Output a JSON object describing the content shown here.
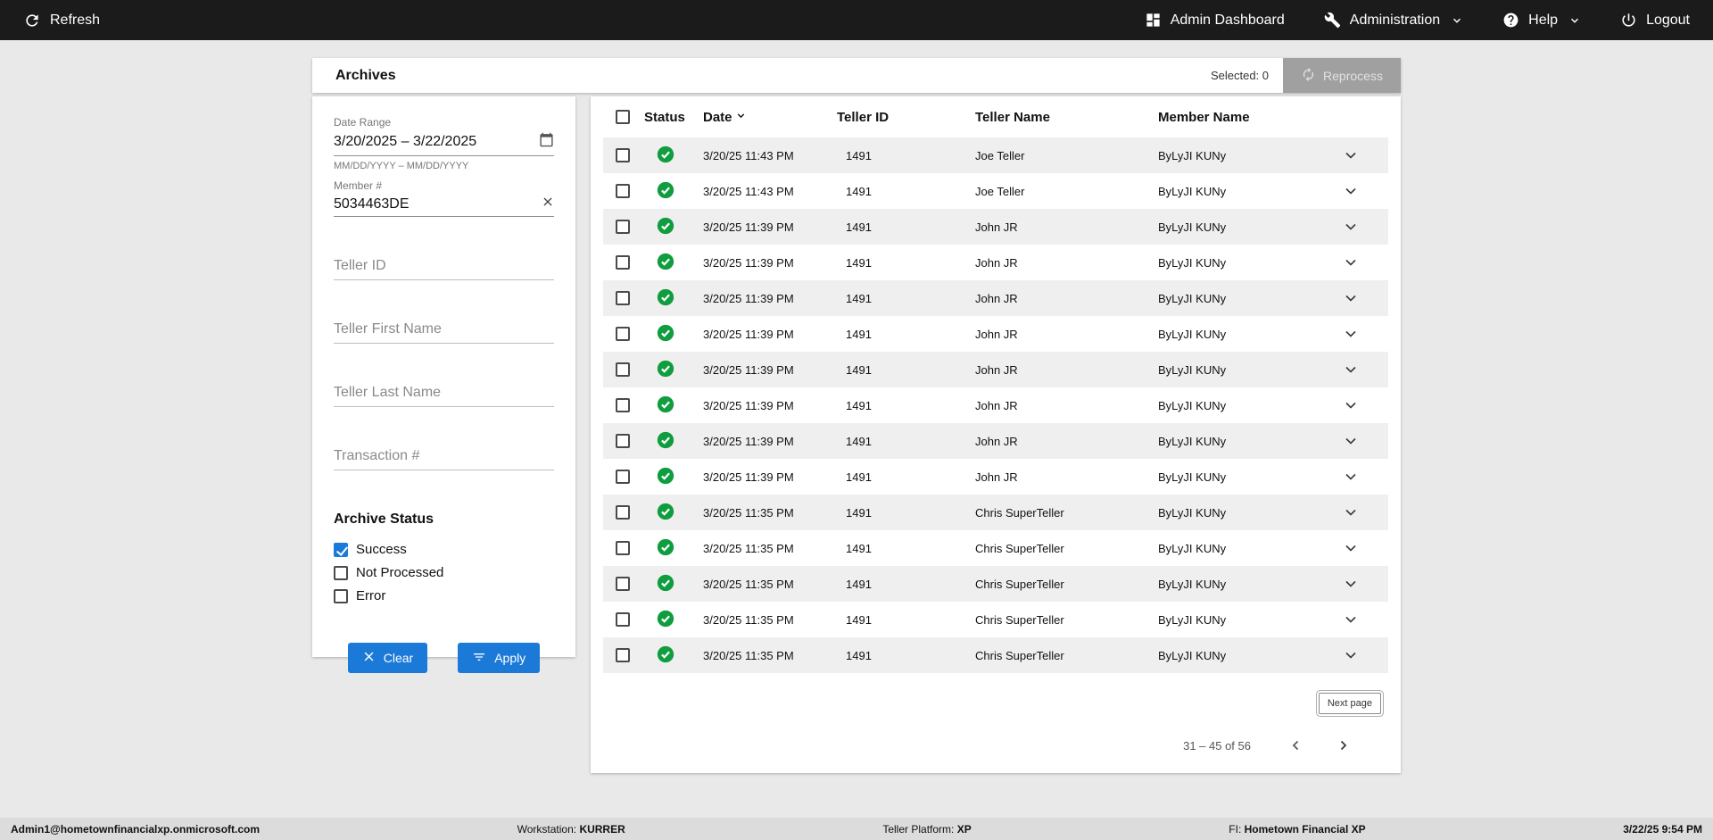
{
  "topbar": {
    "refresh": "Refresh",
    "admin_dashboard": "Admin Dashboard",
    "administration": "Administration",
    "help": "Help",
    "logout": "Logout"
  },
  "header": {
    "title": "Archives",
    "selected": "Selected: 0",
    "reprocess": "Reprocess"
  },
  "filters": {
    "date_range": {
      "label": "Date Range",
      "value": "3/20/2025 – 3/22/2025",
      "hint": "MM/DD/YYYY – MM/DD/YYYY"
    },
    "member": {
      "label": "Member #",
      "value": "5034463DE"
    },
    "teller_id_placeholder": "Teller ID",
    "teller_first_name_placeholder": "Teller First Name",
    "teller_last_name_placeholder": "Teller Last Name",
    "transaction_placeholder": "Transaction #",
    "archive_status_title": "Archive Status",
    "statuses": [
      {
        "label": "Success",
        "checked": true
      },
      {
        "label": "Not Processed",
        "checked": false
      },
      {
        "label": "Error",
        "checked": false
      }
    ],
    "clear": "Clear",
    "apply": "Apply"
  },
  "table": {
    "headers": {
      "status": "Status",
      "date": "Date",
      "teller_id": "Teller ID",
      "teller_name": "Teller Name",
      "member_name": "Member Name"
    },
    "rows": [
      {
        "date": "3/20/25 11:43 PM",
        "teller_id": "1491",
        "teller_name": "Joe Teller",
        "member_name": "ByLyJI KUNy"
      },
      {
        "date": "3/20/25 11:43 PM",
        "teller_id": "1491",
        "teller_name": "Joe Teller",
        "member_name": "ByLyJI KUNy"
      },
      {
        "date": "3/20/25 11:39 PM",
        "teller_id": "1491",
        "teller_name": "John JR",
        "member_name": "ByLyJI KUNy"
      },
      {
        "date": "3/20/25 11:39 PM",
        "teller_id": "1491",
        "teller_name": "John JR",
        "member_name": "ByLyJI KUNy"
      },
      {
        "date": "3/20/25 11:39 PM",
        "teller_id": "1491",
        "teller_name": "John JR",
        "member_name": "ByLyJI KUNy"
      },
      {
        "date": "3/20/25 11:39 PM",
        "teller_id": "1491",
        "teller_name": "John JR",
        "member_name": "ByLyJI KUNy"
      },
      {
        "date": "3/20/25 11:39 PM",
        "teller_id": "1491",
        "teller_name": "John JR",
        "member_name": "ByLyJI KUNy"
      },
      {
        "date": "3/20/25 11:39 PM",
        "teller_id": "1491",
        "teller_name": "John JR",
        "member_name": "ByLyJI KUNy"
      },
      {
        "date": "3/20/25 11:39 PM",
        "teller_id": "1491",
        "teller_name": "John JR",
        "member_name": "ByLyJI KUNy"
      },
      {
        "date": "3/20/25 11:39 PM",
        "teller_id": "1491",
        "teller_name": "John JR",
        "member_name": "ByLyJI KUNy"
      },
      {
        "date": "3/20/25 11:35 PM",
        "teller_id": "1491",
        "teller_name": "Chris SuperTeller",
        "member_name": "ByLyJI KUNy"
      },
      {
        "date": "3/20/25 11:35 PM",
        "teller_id": "1491",
        "teller_name": "Chris SuperTeller",
        "member_name": "ByLyJI KUNy"
      },
      {
        "date": "3/20/25 11:35 PM",
        "teller_id": "1491",
        "teller_name": "Chris SuperTeller",
        "member_name": "ByLyJI KUNy"
      },
      {
        "date": "3/20/25 11:35 PM",
        "teller_id": "1491",
        "teller_name": "Chris SuperTeller",
        "member_name": "ByLyJI KUNy"
      },
      {
        "date": "3/20/25 11:35 PM",
        "teller_id": "1491",
        "teller_name": "Chris SuperTeller",
        "member_name": "ByLyJI KUNy"
      }
    ]
  },
  "pagination": {
    "next_page": "Next page",
    "range": "31 – 45 of 56"
  },
  "footer": {
    "user": "Admin1@hometownfinancialxp.onmicrosoft.com",
    "workstation_label": "Workstation:",
    "workstation": "KURRER",
    "platform_label": "Teller Platform:",
    "platform": "XP",
    "fi_label": "FI:",
    "fi": "Hometown Financial XP",
    "datetime": "3/22/25 9:54 PM"
  },
  "colors": {
    "accent_blue": "#1b79d8",
    "success_green": "#0f9d3f",
    "topbar_bg": "#1b1b1b"
  }
}
